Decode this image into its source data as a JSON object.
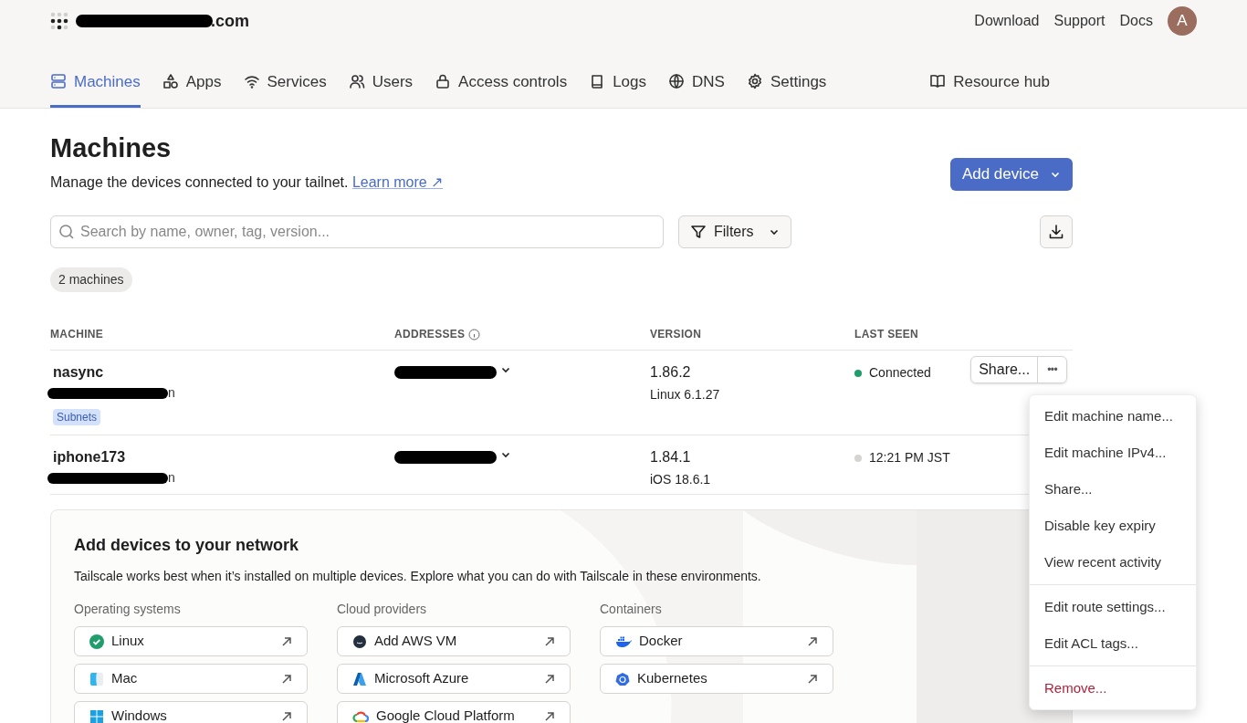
{
  "header": {
    "account_tail": ".com",
    "links": [
      "Download",
      "Support",
      "Docs"
    ],
    "avatar": "A"
  },
  "tabs": [
    {
      "label": "Machines",
      "selected": true
    },
    {
      "label": "Apps",
      "selected": false
    },
    {
      "label": "Services",
      "selected": false
    },
    {
      "label": "Users",
      "selected": false
    },
    {
      "label": "Access controls",
      "selected": false
    },
    {
      "label": "Logs",
      "selected": false
    },
    {
      "label": "DNS",
      "selected": false
    },
    {
      "label": "Settings",
      "selected": false
    }
  ],
  "resource_hub": "Resource hub",
  "page": {
    "title": "Machines",
    "description": "Manage the devices connected to your tailnet.",
    "learn_more": "Learn more ↗",
    "add_device": "Add device"
  },
  "search": {
    "placeholder": "Search by name, owner, tag, version..."
  },
  "filters": "Filters",
  "count_badge": "2 machines",
  "table": {
    "columns": [
      "MACHINE",
      "ADDRESSES",
      "VERSION",
      "LAST SEEN"
    ],
    "rows": [
      {
        "name": "nasync",
        "owner_tail": "n",
        "tags": [
          "Subnets"
        ],
        "version": "1.86.2",
        "os": "Linux 6.1.27",
        "status": "Connected",
        "online": true,
        "actions": true
      },
      {
        "name": "iphone173",
        "owner_tail": "n",
        "tags": [],
        "version": "1.84.1",
        "os": "iOS 18.6.1",
        "status": "12:21 PM JST",
        "online": false,
        "actions": false
      }
    ]
  },
  "row_actions": {
    "share": "Share...",
    "more": "•••"
  },
  "menu": [
    {
      "label": "Edit machine name...",
      "kind": "normal"
    },
    {
      "label": "Edit machine IPv4...",
      "kind": "normal"
    },
    {
      "label": "Share...",
      "kind": "normal"
    },
    {
      "label": "Disable key expiry",
      "kind": "normal"
    },
    {
      "label": "View recent activity",
      "kind": "normal"
    },
    {
      "label": "Edit route settings...",
      "kind": "normal"
    },
    {
      "label": "Edit ACL tags...",
      "kind": "normal"
    },
    {
      "label": "Remove...",
      "kind": "danger"
    }
  ],
  "add_devices": {
    "title": "Add devices to your network",
    "text": "Tailscale works best when it’s installed on multiple devices. Explore what you can do with Tailscale in these environments.",
    "groups": [
      {
        "title": "Operating systems",
        "items": [
          "Linux",
          "Mac",
          "Windows"
        ]
      },
      {
        "title": "Cloud providers",
        "items": [
          "Add AWS VM",
          "Microsoft Azure",
          "Google Cloud Platform"
        ]
      },
      {
        "title": "Containers",
        "items": [
          "Docker",
          "Kubernetes"
        ]
      }
    ]
  }
}
